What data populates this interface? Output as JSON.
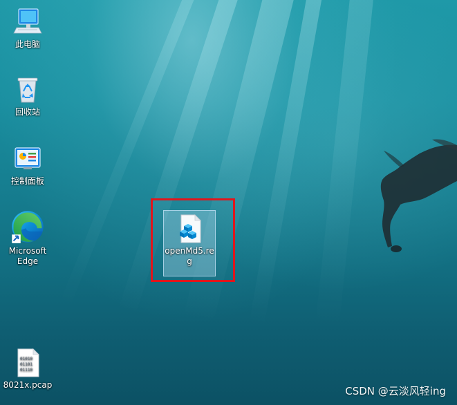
{
  "desktop": {
    "icons": [
      {
        "name": "此电脑",
        "icon": "this-pc-icon"
      },
      {
        "name": "回收站",
        "icon": "recycle-bin-icon"
      },
      {
        "name": "控制面板",
        "icon": "control-panel-icon"
      },
      {
        "name": "Microsoft Edge",
        "icon": "edge-icon"
      },
      {
        "name": "8021x.pcap",
        "icon": "pcap-file-icon"
      }
    ],
    "selected_file": {
      "name": "openMd5.reg",
      "name_line1": "openMd5.re",
      "name_line2": "g",
      "icon": "registry-file-icon"
    }
  },
  "annotation": {
    "highlight_color": "#e0161c"
  },
  "watermark": "CSDN @云淡风轻ing"
}
